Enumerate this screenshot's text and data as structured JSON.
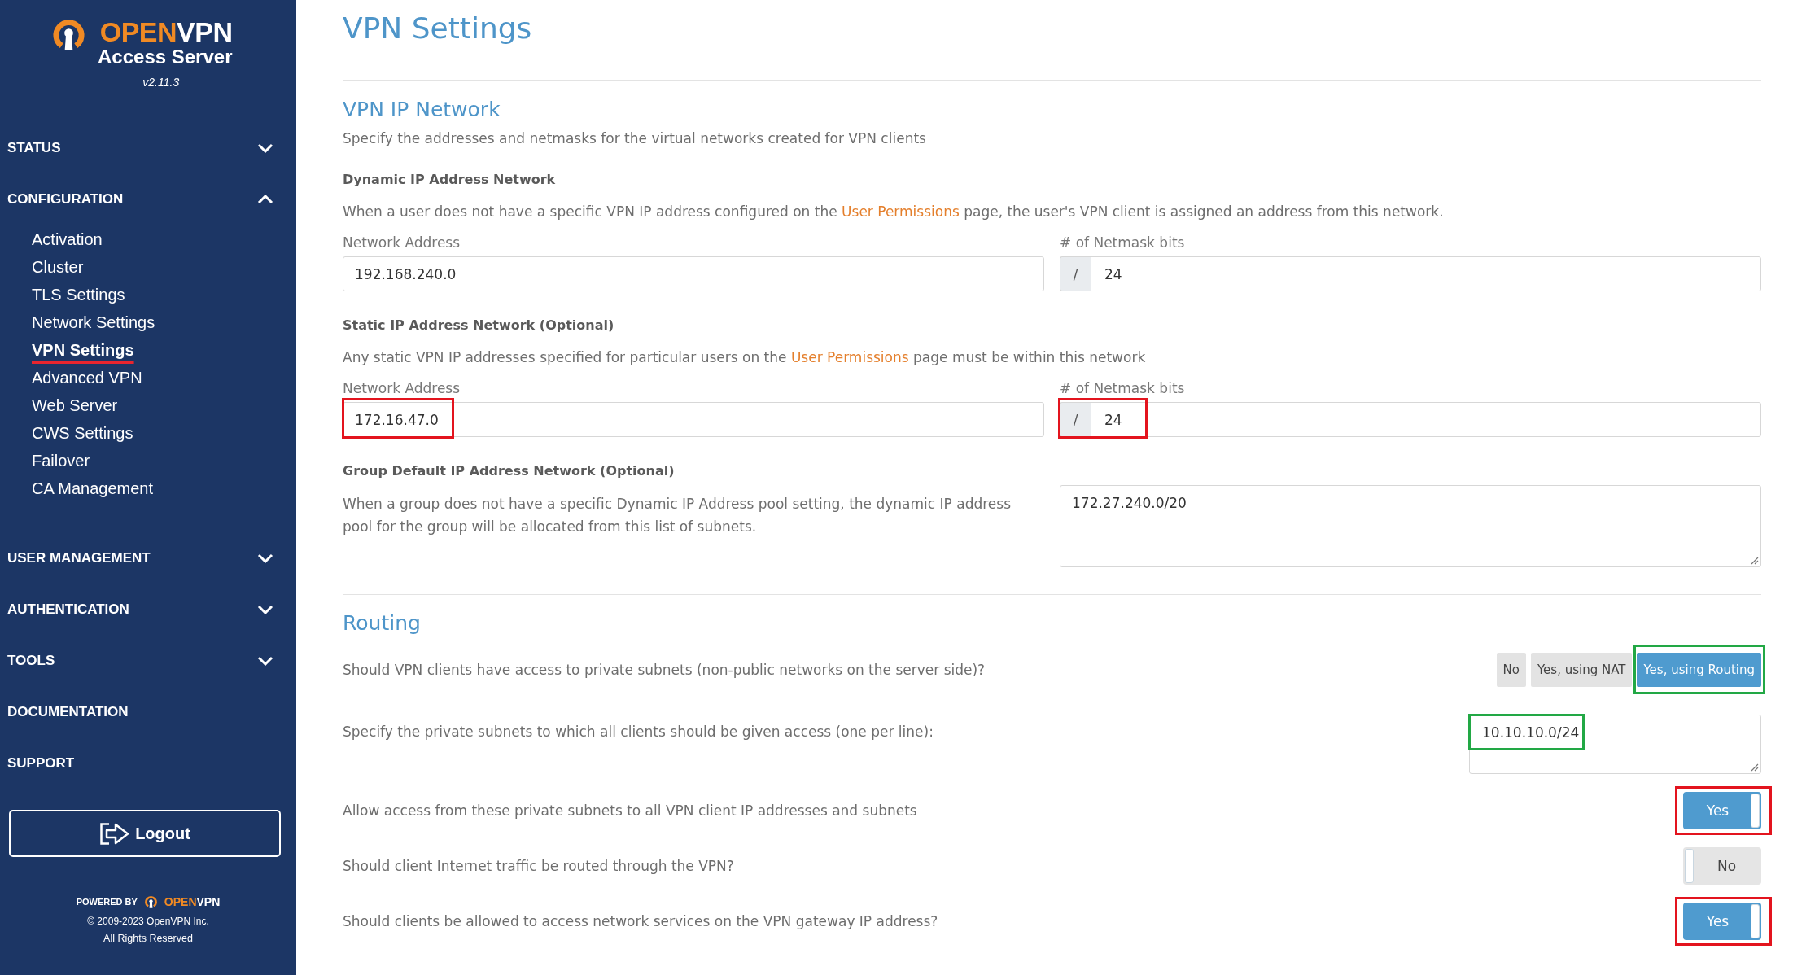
{
  "sidebar": {
    "logo": {
      "brand_first": "OPEN",
      "brand_second": "VPN",
      "product": "Access Server",
      "version": "v2.11.3"
    },
    "nav": [
      {
        "kind": "section",
        "label": "STATUS",
        "expanded": false
      },
      {
        "kind": "section",
        "label": "CONFIGURATION",
        "expanded": true,
        "children": [
          {
            "label": "Activation",
            "selected": false
          },
          {
            "label": "Cluster",
            "selected": false
          },
          {
            "label": "TLS Settings",
            "selected": false
          },
          {
            "label": "Network Settings",
            "selected": false
          },
          {
            "label": "VPN Settings",
            "selected": true
          },
          {
            "label": "Advanced VPN",
            "selected": false
          },
          {
            "label": "Web Server",
            "selected": false
          },
          {
            "label": "CWS Settings",
            "selected": false
          },
          {
            "label": "Failover",
            "selected": false
          },
          {
            "label": "CA Management",
            "selected": false
          }
        ]
      },
      {
        "kind": "section",
        "label": "USER MANAGEMENT",
        "expanded": false
      },
      {
        "kind": "section",
        "label": "AUTHENTICATION",
        "expanded": false
      },
      {
        "kind": "section",
        "label": "TOOLS",
        "expanded": false
      },
      {
        "kind": "link",
        "label": "DOCUMENTATION"
      },
      {
        "kind": "link",
        "label": "SUPPORT"
      }
    ],
    "logout_button": "Logout",
    "footer": {
      "powered_by": "POWERED BY",
      "brand_first": "OPEN",
      "brand_second": "VPN",
      "copyright": "© 2009-2023 OpenVPN Inc.",
      "rights": "All Rights Reserved"
    }
  },
  "page_title": "VPN Settings",
  "vpn_ip_network": {
    "title": "VPN IP Network",
    "description": "Specify the addresses and netmasks for the virtual networks created for VPN clients",
    "dynamic": {
      "heading": "Dynamic IP Address Network",
      "text_before": "When a user does not have a specific VPN IP address configured on the",
      "link": "User Permissions",
      "text_after": "page, the user's VPN client is assigned an address from this network.",
      "address_label": "Network Address",
      "address": {
        "value": "192.168.240.0"
      },
      "netmask_label": "# of Netmask bits",
      "netmask_prefix": "/",
      "netmask": {
        "value": "24"
      }
    },
    "static": {
      "heading": "Static IP Address Network (Optional)",
      "text_before": "Any static VPN IP addresses specified for particular users on the",
      "link": "User Permissions",
      "text_after": "page must be within this network",
      "address_label": "Network Address",
      "address": {
        "value": "172.16.47.0",
        "highlight": {
          "color": "#e3141e"
        }
      },
      "netmask_label": "# of Netmask bits",
      "netmask_prefix": "/",
      "netmask": {
        "value": "24",
        "highlight": {
          "color": "#e3141e"
        }
      }
    },
    "group_default": {
      "heading": "Group Default IP Address Network (Optional)",
      "description": "When a group does not have a specific Dynamic IP Address pool setting, the dynamic IP address pool for the group will be allocated from this list of subnets.",
      "value": "172.27.240.0/20"
    }
  },
  "routing": {
    "title": "Routing",
    "rows": [
      {
        "kind": "choice",
        "question": "Should VPN clients have access to private subnets (non-public networks on the server side)?",
        "options": [
          {
            "label": "No",
            "selected": false
          },
          {
            "label": "Yes, using NAT",
            "selected": false
          },
          {
            "label": "Yes, using Routing",
            "selected": true,
            "highlight": {
              "color": "#22a845"
            }
          }
        ]
      },
      {
        "kind": "textarea",
        "question": "Specify the private subnets to which all clients should be given access (one per line):",
        "value": "10.10.10.0/24",
        "highlight": {
          "color": "#22a845"
        }
      },
      {
        "kind": "toggle",
        "question": "Allow access from these private subnets to all VPN client IP addresses and subnets",
        "on": true,
        "label": "Yes",
        "highlight": {
          "color": "#e3141e"
        }
      },
      {
        "kind": "toggle",
        "question": "Should client Internet traffic be routed through the VPN?",
        "on": false,
        "label": "No"
      },
      {
        "kind": "toggle",
        "question": "Should clients be allowed to access network services on the VPN gateway IP address?",
        "on": true,
        "label": "Yes",
        "highlight": {
          "color": "#e3141e"
        }
      }
    ]
  }
}
